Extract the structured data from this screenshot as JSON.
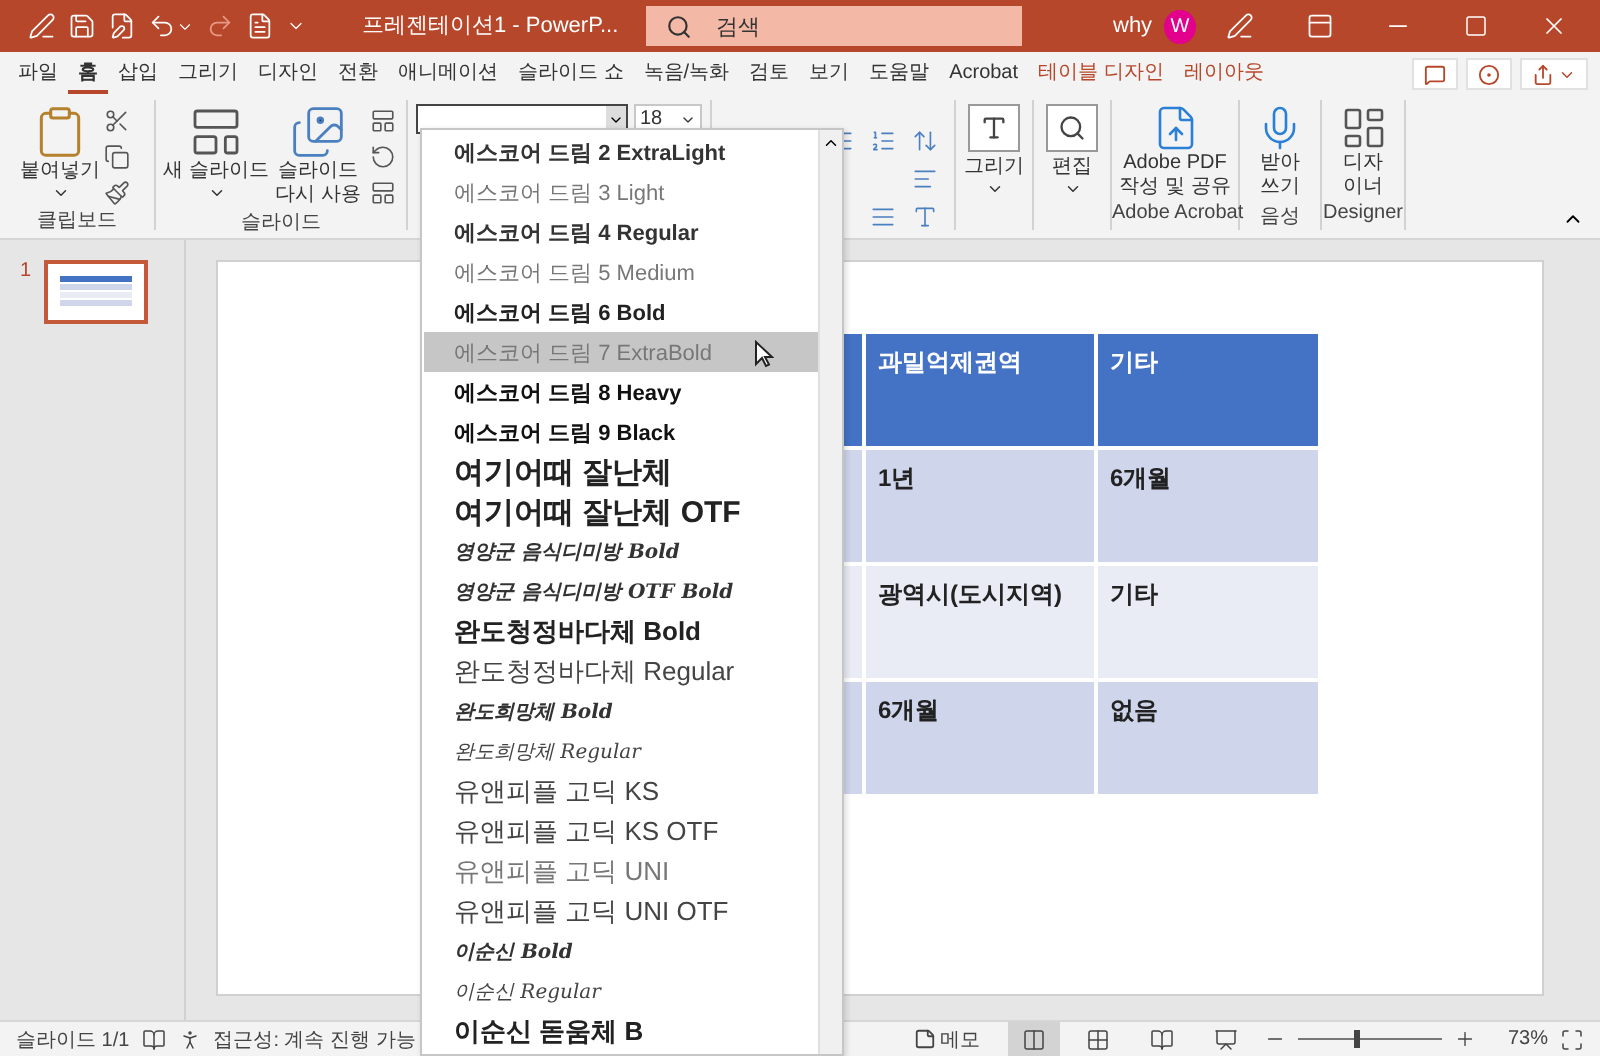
{
  "title_bar": {
    "title": "프레젠테이션1  -  PowerP...",
    "search": {
      "placeholder": "검색"
    },
    "user": "why",
    "avatar": "W"
  },
  "menu_tabs": [
    {
      "label": "파일",
      "kind": "normal",
      "selected": false
    },
    {
      "label": "홈",
      "kind": "normal",
      "selected": true
    },
    {
      "label": "삽입",
      "kind": "normal",
      "selected": false
    },
    {
      "label": "그리기",
      "kind": "normal",
      "selected": false
    },
    {
      "label": "디자인",
      "kind": "normal",
      "selected": false
    },
    {
      "label": "전환",
      "kind": "normal",
      "selected": false
    },
    {
      "label": "애니메이션",
      "kind": "normal",
      "selected": false
    },
    {
      "label": "슬라이드 쇼",
      "kind": "normal",
      "selected": false
    },
    {
      "label": "녹음/녹화",
      "kind": "normal",
      "selected": false
    },
    {
      "label": "검토",
      "kind": "normal",
      "selected": false
    },
    {
      "label": "보기",
      "kind": "normal",
      "selected": false
    },
    {
      "label": "도움말",
      "kind": "normal",
      "selected": false
    },
    {
      "label": "Acrobat",
      "kind": "normal",
      "selected": false
    },
    {
      "label": "테이블 디자인",
      "kind": "context",
      "selected": false
    },
    {
      "label": "레이아웃",
      "kind": "context",
      "selected": false
    }
  ],
  "ribbon": {
    "clipboard": {
      "paste": "붙여넣기",
      "label": "클립보드"
    },
    "slides": {
      "new_slide": "새 슬라이드",
      "reuse": "슬라이드 다시 사용",
      "label": "슬라이드"
    },
    "font": {
      "size": "18"
    },
    "drawing": {
      "button": "그리기"
    },
    "editing": {
      "button": "편집"
    },
    "acrobat": {
      "button": "Adobe PDF 작성 및 공유",
      "label": "Adobe Acrobat"
    },
    "voice": {
      "button": "받아쓰기",
      "label": "음성"
    },
    "designer": {
      "button": "디자이너",
      "label": "Designer"
    }
  },
  "font_list": [
    {
      "label": "에스코어 드림 2 ExtraLight",
      "kind": "medium",
      "selected": false
    },
    {
      "label": "에스코어 드림 3 Light",
      "kind": "light",
      "selected": false
    },
    {
      "label": "에스코어 드림 4 Regular",
      "kind": "medium",
      "selected": false
    },
    {
      "label": "에스코어 드림 5 Medium",
      "kind": "light",
      "selected": false
    },
    {
      "label": "에스코어 드림 6 Bold",
      "kind": "bold",
      "selected": false
    },
    {
      "label": "에스코어 드림 7 ExtraBold",
      "kind": "light",
      "selected": true
    },
    {
      "label": "에스코어 드림 8 Heavy",
      "kind": "heavy",
      "selected": false
    },
    {
      "label": "에스코어 드림 9 Black",
      "kind": "heavy",
      "selected": false
    },
    {
      "label": "여기어때 잘난체",
      "kind": "display",
      "selected": false
    },
    {
      "label": "여기어때 잘난체 OTF",
      "kind": "display",
      "selected": false
    },
    {
      "label": "영양군 음식디미방 Bold",
      "kind": "script-bold",
      "selected": false
    },
    {
      "label": "영양군 음식디미방 OTF Bold",
      "kind": "script-bold",
      "selected": false
    },
    {
      "label": "완도청정바다체 Bold",
      "kind": "large-bold",
      "selected": false
    },
    {
      "label": "완도청정바다체 Regular",
      "kind": "large",
      "selected": false
    },
    {
      "label": "완도희망체 Bold",
      "kind": "script-bold",
      "selected": false
    },
    {
      "label": "완도희망체 Regular",
      "kind": "script",
      "selected": false
    },
    {
      "label": "유앤피플 고딕 KS",
      "kind": "large",
      "selected": false
    },
    {
      "label": "유앤피플 고딕 KS OTF",
      "kind": "large",
      "selected": false
    },
    {
      "label": "유앤피플 고딕 UNI",
      "kind": "large-light",
      "selected": false
    },
    {
      "label": "유앤피플 고딕 UNI OTF",
      "kind": "large",
      "selected": false
    },
    {
      "label": "이순신 Bold",
      "kind": "script-bold",
      "selected": false
    },
    {
      "label": "이순신 Regular",
      "kind": "script",
      "selected": false
    },
    {
      "label": "이순신 돋움체 B",
      "kind": "large-bold",
      "selected": false
    }
  ],
  "slide_pane": [
    {
      "number": "1",
      "selected": true
    }
  ],
  "table": {
    "header": [
      "과밀억제권역",
      "기타"
    ],
    "rows": [
      [
        "1년",
        "6개월"
      ],
      [
        "광역시(도시지역)",
        "기타"
      ],
      [
        "6개월",
        "없음"
      ]
    ]
  },
  "status_bar": {
    "slide": "슬라이드 1/1",
    "accessibility": "접근성: 계속 진행 가능",
    "notes": "메모",
    "views": [
      {
        "kind": "normal",
        "selected": true
      },
      {
        "kind": "sorter",
        "selected": false
      },
      {
        "kind": "reading",
        "selected": false
      },
      {
        "kind": "show",
        "selected": false
      }
    ],
    "zoom": {
      "level": 0.4,
      "reading": "73%"
    }
  }
}
